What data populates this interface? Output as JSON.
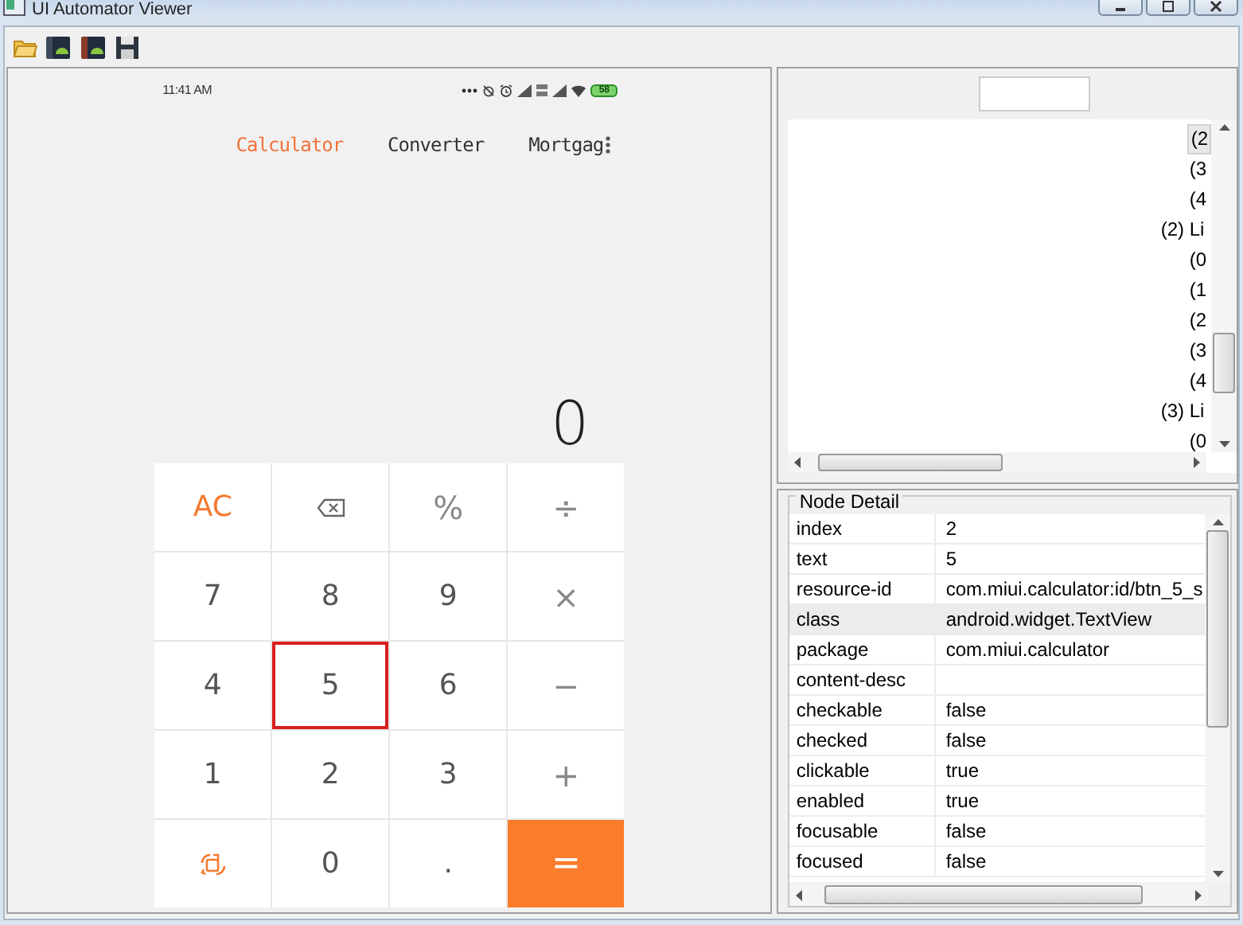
{
  "window": {
    "title": "UI Automator Viewer"
  },
  "device": {
    "status_bar": {
      "time": "11:41 AM",
      "battery": "58"
    },
    "tabs": [
      {
        "label": "Calculator",
        "selected": true
      },
      {
        "label": "Converter",
        "selected": false
      },
      {
        "label": "Mortgag",
        "selected": false
      }
    ],
    "display": "0",
    "keys": [
      {
        "kind": "function",
        "label": "AC",
        "selected": false
      },
      {
        "kind": "backspace",
        "selected": false
      },
      {
        "kind": "operator",
        "label": "%",
        "selected": false
      },
      {
        "kind": "operator",
        "label": "÷",
        "selected": false
      },
      {
        "kind": "digit",
        "label": "7",
        "selected": false
      },
      {
        "kind": "digit",
        "label": "8",
        "selected": false
      },
      {
        "kind": "digit",
        "label": "9",
        "selected": false
      },
      {
        "kind": "operator",
        "label": "×",
        "selected": false
      },
      {
        "kind": "digit",
        "label": "4",
        "selected": false
      },
      {
        "kind": "digit",
        "label": "5",
        "selected": true
      },
      {
        "kind": "digit",
        "label": "6",
        "selected": false
      },
      {
        "kind": "operator",
        "label": "−",
        "selected": false
      },
      {
        "kind": "digit",
        "label": "1",
        "selected": false
      },
      {
        "kind": "digit",
        "label": "2",
        "selected": false
      },
      {
        "kind": "digit",
        "label": "3",
        "selected": false
      },
      {
        "kind": "operator",
        "label": "+",
        "selected": false
      },
      {
        "kind": "mode-switch",
        "selected": false
      },
      {
        "kind": "digit",
        "label": "0",
        "selected": false
      },
      {
        "kind": "digit",
        "label": ".",
        "selected": false
      },
      {
        "kind": "equals",
        "label": "=",
        "selected": false
      }
    ]
  },
  "tree": {
    "items": [
      {
        "children": [
          {
            "label": "(2",
            "selected": true
          },
          {
            "label": "(3",
            "selected": false
          },
          {
            "label": "(4",
            "selected": false
          }
        ]
      },
      {
        "label": "(2) Li",
        "selected": false,
        "children": [
          {
            "label": "(0",
            "selected": false
          },
          {
            "label": "(1",
            "selected": false
          },
          {
            "label": "(2",
            "selected": false
          },
          {
            "label": "(3",
            "selected": false
          },
          {
            "label": "(4",
            "selected": false
          }
        ]
      },
      {
        "label": "(3) Li",
        "selected": false,
        "children": [
          {
            "label": "(0",
            "selected": false
          }
        ]
      }
    ]
  },
  "node_detail": {
    "title": "Node Detail",
    "rows": [
      {
        "key": "index",
        "value": "2",
        "selected": false
      },
      {
        "key": "text",
        "value": "5",
        "selected": false
      },
      {
        "key": "resource-id",
        "value": "com.miui.calculator:id/btn_5_s",
        "selected": false
      },
      {
        "key": "class",
        "value": "android.widget.TextView",
        "selected": true
      },
      {
        "key": "package",
        "value": "com.miui.calculator",
        "selected": false
      },
      {
        "key": "content-desc",
        "selected": false
      },
      {
        "key": "checkable",
        "value": "false",
        "selected": false
      },
      {
        "key": "checked",
        "value": "false",
        "selected": false
      },
      {
        "key": "clickable",
        "value": "true",
        "selected": false
      },
      {
        "key": "enabled",
        "value": "true",
        "selected": false
      },
      {
        "key": "focusable",
        "value": "false",
        "selected": false
      },
      {
        "key": "focused",
        "value": "false",
        "selected": false
      }
    ]
  }
}
